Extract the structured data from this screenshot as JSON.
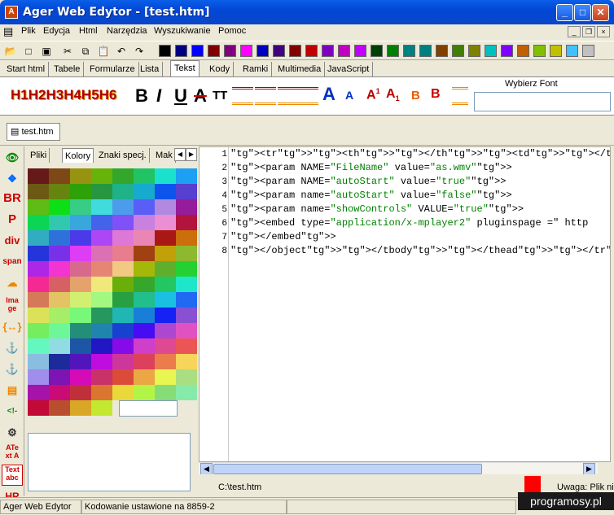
{
  "window": {
    "title": "Ager Web Edytor - [test.htm]",
    "icon": "app-icon"
  },
  "menu": [
    "Plik",
    "Edycja",
    "Html",
    "Narzędzia",
    "Wyszukiwanie",
    "Pomoc"
  ],
  "toolbar": {
    "colors": [
      "#000000",
      "#000080",
      "#0000ff",
      "#800000",
      "#800080",
      "#ff00ff",
      "#0000c0",
      "#400080",
      "#800000",
      "#c00000",
      "#8000c0",
      "#c000c0",
      "#c000ff",
      "#004000",
      "#008000",
      "#008080",
      "#008080",
      "#804000",
      "#408000",
      "#808000",
      "#00c0c0",
      "#8000ff",
      "#c06000",
      "#80c000",
      "#c0c000",
      "#40c0ff",
      "#c0c0c0"
    ]
  },
  "tabs": [
    "Start html",
    "Tabele",
    "Formularze",
    "Lista",
    "Tekst",
    "Kody",
    "Ramki",
    "Multimedia",
    "JavaScript"
  ],
  "format": {
    "headings": "H1H2H3H4H5H6",
    "bold": "B",
    "italic": "I",
    "underline": "U",
    "strike": "A",
    "tt": "TT",
    "font_label": "Wybierz Font",
    "big_a": "A",
    "small_a": "A",
    "sup": "A",
    "sub": "A",
    "b1": "B",
    "b2": "B"
  },
  "doc_tab": "test.htm",
  "left_icons": [
    "eye-icon",
    "windows-icon",
    "BR",
    "P",
    "div",
    "span",
    "cloud-icon",
    "Ima ge",
    "braces-icon",
    "anchor-icon",
    "anchor-icon",
    "form-icon",
    "comment-icon",
    "gear-icon",
    "text-icon",
    "textbox-icon",
    "HR"
  ],
  "panel_tabs": [
    "Pliki",
    "Kolory",
    "Znaki specj.",
    "Mak"
  ],
  "editor_lines": [
    {
      "n": "1",
      "t": "<tr><th></th><td></td><thead><tbody><object ID=\"MediaPla"
    },
    {
      "n": "2",
      "t": "<param NAME=\"FileName\" value=\"as.wmv\">"
    },
    {
      "n": "3",
      "t": "<param NAME=\"autoStart\" value=\"true\">"
    },
    {
      "n": "4",
      "t": "<param name=\"autoStart\" value=\"false\">"
    },
    {
      "n": "5",
      "t": "<param name=\"showControls\" VALUE=\"true\">"
    },
    {
      "n": "6",
      "t": "<embed type=\"application/x-mplayer2\" pluginspage =\" http"
    },
    {
      "n": "7",
      "t": "</embed>"
    },
    {
      "n": "8",
      "t": "</object></tbody></thead></tr>a"
    }
  ],
  "path": "C:\\test.htm",
  "warning": "Uwaga: Plik ni",
  "status": [
    "Ager Web Edytor",
    "Kodowanie ustawione na 8859-2"
  ],
  "watermark": "programosy.pl"
}
